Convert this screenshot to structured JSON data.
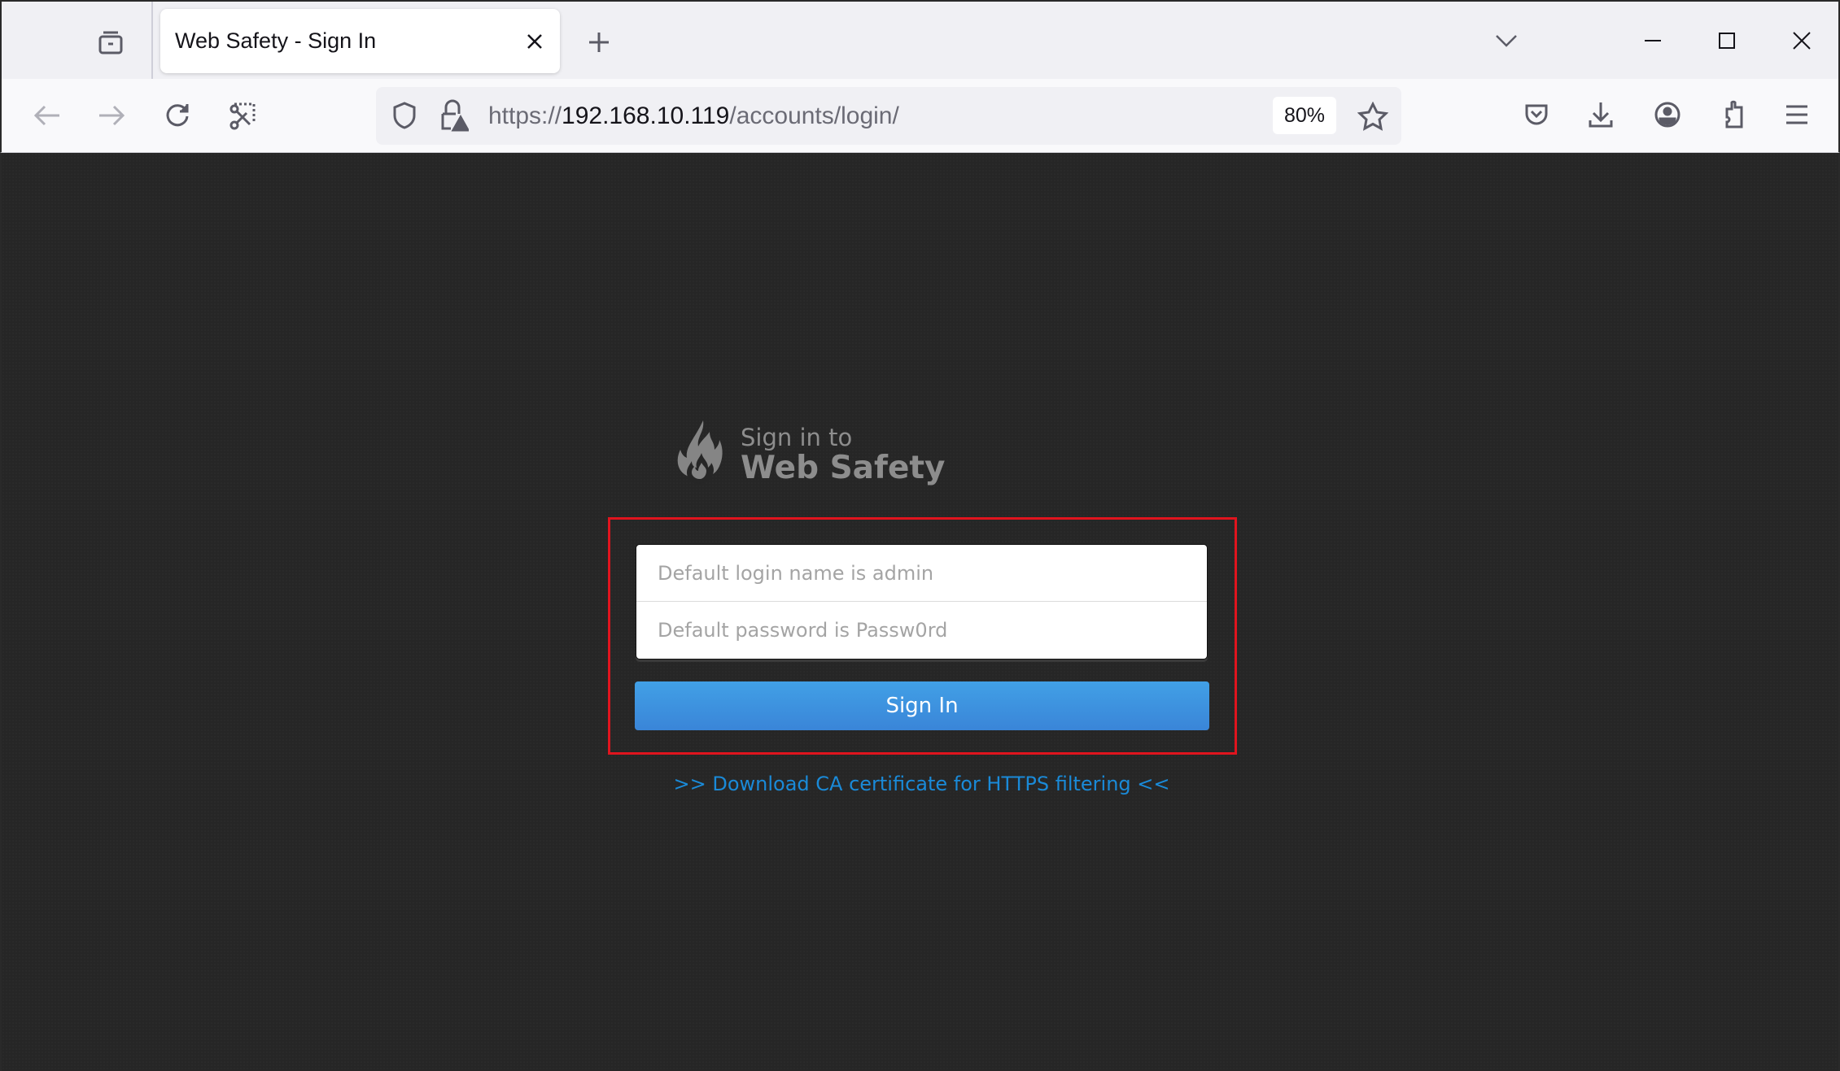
{
  "browser": {
    "tab": {
      "title": "Web Safety - Sign In"
    },
    "url": {
      "scheme": "https://",
      "host": "192.168.10.119",
      "path": "/accounts/login/"
    },
    "zoom_level": "80%",
    "icons": {
      "tab_list": "tab-list-icon",
      "new_tab": "plus-icon",
      "tabs_dropdown": "chevron-down-icon",
      "minimize": "minimize-icon",
      "maximize": "maximize-icon",
      "close_window": "close-icon",
      "back": "arrow-left-icon",
      "forward": "arrow-right-icon",
      "reload": "reload-icon",
      "screenshot": "screenshot-icon",
      "tracking_protection": "shield-icon",
      "insecure_lock": "lock-warning-icon",
      "bookmark": "star-icon",
      "pocket": "pocket-icon",
      "downloads": "download-icon",
      "account": "account-icon",
      "extensions": "puzzle-icon",
      "menu": "hamburger-menu-icon"
    }
  },
  "page": {
    "brand": {
      "subtitle": "Sign in to",
      "title": "Web Safety",
      "logo": "flame-icon"
    },
    "form": {
      "login_placeholder": "Default login name is admin",
      "password_placeholder": "Default password is Passw0rd",
      "submit_label": "Sign In"
    },
    "ca_link": ">> Download CA certificate for HTTPS filtering <<",
    "colors": {
      "highlight": "#e0141e",
      "button": "#3a8fdc",
      "link": "#1a8ad8"
    }
  }
}
